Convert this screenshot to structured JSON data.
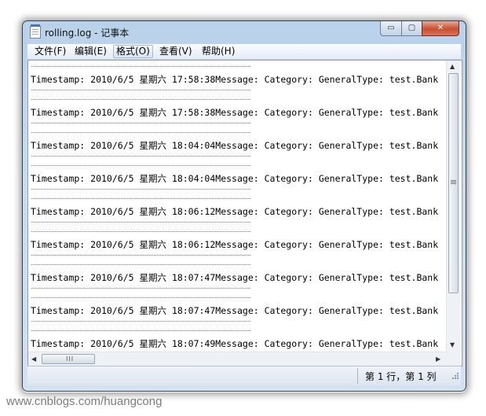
{
  "window": {
    "title": "rolling.log - 记事本",
    "controls": {
      "minimize": "▭",
      "maximize": "▢",
      "close": "✕"
    }
  },
  "menu": {
    "items": [
      {
        "label": "文件(F)"
      },
      {
        "label": "编辑(E)"
      },
      {
        "label": "格式(O)"
      },
      {
        "label": "查看(V)"
      },
      {
        "label": "帮助(H)"
      }
    ]
  },
  "editor": {
    "separator": "----------------------------------------",
    "lines": [
      "Timestamp: 2010/6/5 星期六 17:58:38Message: Category: GeneralType: test.Bank",
      "Timestamp: 2010/6/5 星期六 17:58:38Message: Category: GeneralType: test.Bank",
      "Timestamp: 2010/6/5 星期六 18:04:04Message: Category: GeneralType: test.Bank",
      "Timestamp: 2010/6/5 星期六 18:04:04Message: Category: GeneralType: test.Bank",
      "Timestamp: 2010/6/5 星期六 18:06:12Message: Category: GeneralType: test.Bank",
      "Timestamp: 2010/6/5 星期六 18:06:12Message: Category: GeneralType: test.Bank",
      "Timestamp: 2010/6/5 星期六 18:07:47Message: Category: GeneralType: test.Bank",
      "Timestamp: 2010/6/5 星期六 18:07:47Message: Category: GeneralType: test.Bank",
      "Timestamp: 2010/6/5 星期六 18:07:49Message: Category: GeneralType: test.Bank"
    ]
  },
  "scrollbars": {
    "up_arrow": "▲",
    "down_arrow": "▼",
    "left_arrow": "◀",
    "right_arrow": "▶",
    "vertical_grip": "≡",
    "horizontal_grip": "III"
  },
  "status": {
    "position": "第 1 行，第 1 列"
  },
  "watermark": "www.cnblogs.com/huangcong"
}
